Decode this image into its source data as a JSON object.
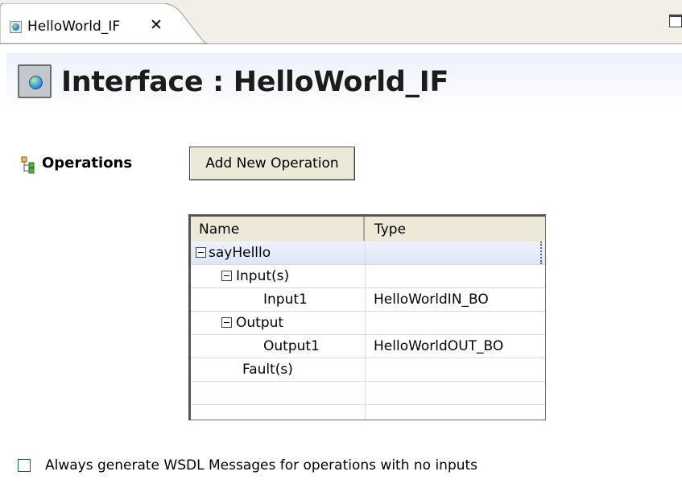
{
  "tab": {
    "title": "HelloWorld_IF",
    "close_glyph": "✕",
    "icon": "interface-icon"
  },
  "header": {
    "title": "Interface : HelloWorld_IF",
    "icon": "globe-interface-icon"
  },
  "operations": {
    "label": "Operations",
    "icon": "operations-tree-icon",
    "add_button_label": "Add New Operation"
  },
  "table": {
    "columns": [
      "Name",
      "Type"
    ],
    "rows": [
      {
        "name": "sayHelllo",
        "type": "",
        "level": 0,
        "expandable": true,
        "selected": true
      },
      {
        "name": "Input(s)",
        "type": "",
        "level": 1,
        "expandable": true,
        "selected": false
      },
      {
        "name": "Input1",
        "type": "HelloWorldIN_BO",
        "level": 2,
        "expandable": false,
        "selected": false
      },
      {
        "name": "Output",
        "type": "",
        "level": 1,
        "expandable": true,
        "selected": false
      },
      {
        "name": "Output1",
        "type": "HelloWorldOUT_BO",
        "level": 2,
        "expandable": false,
        "selected": false
      },
      {
        "name": "Fault(s)",
        "type": "",
        "level": 1.5,
        "expandable": false,
        "selected": false
      },
      {
        "name": "",
        "type": "",
        "level": 0,
        "expandable": false,
        "selected": false
      },
      {
        "name": "",
        "type": "",
        "level": 0,
        "expandable": false,
        "selected": false
      }
    ]
  },
  "options": {
    "wsdl_checkbox_label": "Always generate WSDL Messages for operations with no inputs",
    "wsdl_checkbox_checked": false
  }
}
